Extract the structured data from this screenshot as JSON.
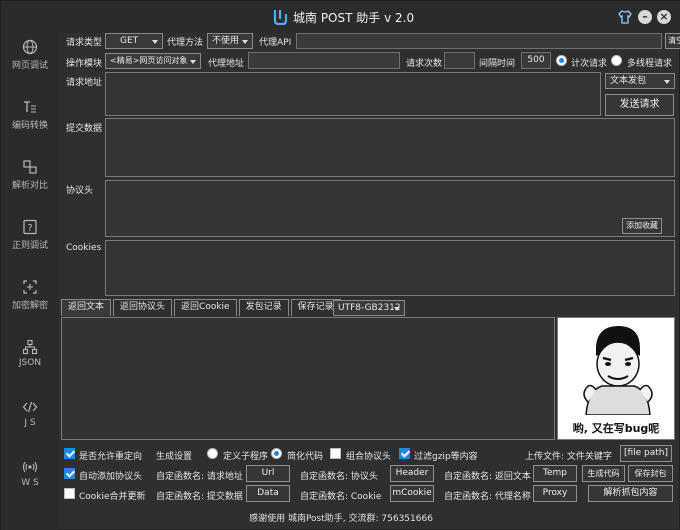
{
  "window": {
    "title": "城南 POST 助手 v 2.0"
  },
  "sidebar": {
    "items": [
      {
        "label": "网页调试",
        "icon": "globe-icon"
      },
      {
        "label": "编码转换",
        "icon": "text-format-icon"
      },
      {
        "label": "解析对比",
        "icon": "compare-icon"
      },
      {
        "label": "正则调试",
        "icon": "regex-icon"
      },
      {
        "label": "加密解密",
        "icon": "encrypt-icon"
      },
      {
        "label": "JSON",
        "icon": "json-icon"
      },
      {
        "label": "J S",
        "icon": "code-icon"
      },
      {
        "label": "W S",
        "icon": "broadcast-icon"
      }
    ]
  },
  "request": {
    "type_label": "请求类型",
    "type_value": "GET",
    "proxy_method_label": "代理方法",
    "proxy_method_value": "不使用",
    "proxy_api_label": "代理API",
    "proxy_api_value": "",
    "clear_all": "清空全部",
    "module_label": "操作模块",
    "module_value": "<精易>网页访问对象",
    "proxy_addr_label": "代理地址",
    "proxy_addr_value": "",
    "count_label": "请求次数",
    "count_value": "",
    "interval_label": "间隔时间",
    "interval_value": "500",
    "mode_timed": "计次请求",
    "mode_multi": "多线程请求",
    "url_label": "请求地址",
    "url_value": "",
    "text_send": "文本发包",
    "send_button": "发送请求",
    "postdata_label": "提交数据",
    "headers_label": "协议头",
    "add_favorite": "添加收藏",
    "cookies_label": "Cookies"
  },
  "tabs": {
    "items": [
      "返回文本",
      "返回协议头",
      "返回Cookie",
      "发包记录",
      "保存记录"
    ],
    "encoding": "UTF8-GB2312"
  },
  "meme": {
    "caption": "哟, 又在写bug呢"
  },
  "options": {
    "allow_redirect": "是否允许重定向",
    "gen_settings": "生成设置",
    "custom_sub": "定义子程序",
    "simple_code": "简化代码",
    "combine_headers": "组合协议头",
    "filter_gzip": "过滤gzip等内容",
    "upload_label": "上传文件: 文件关键字",
    "file_path": "[file path]",
    "auto_headers": "自动添加协议头",
    "fn_url_label": "自定函数名: 请求地址",
    "fn_url": "Url",
    "fn_header_label": "自定函数名: 协议头",
    "fn_header": "Header",
    "fn_return_label": "自定函数名: 返回文本",
    "fn_return": "Temp",
    "gen_code": "生成代码",
    "save_packet": "保存封包",
    "cookie_merge": "Cookie合并更新",
    "fn_data_label": "自定函数名: 提交数据",
    "fn_data": "Data",
    "fn_cookie_label": "自定函数名: Cookie",
    "fn_cookie": "mCookie",
    "fn_proxy_label": "自定函数名: 代理名称",
    "fn_proxy": "Proxy",
    "parse_capture": "解析抓包内容"
  },
  "footer": {
    "text": "感谢使用 城南Post助手, 交流群: 756351666"
  },
  "colors": {
    "accent": "#1e88e5",
    "background": "#2f2f2f"
  }
}
